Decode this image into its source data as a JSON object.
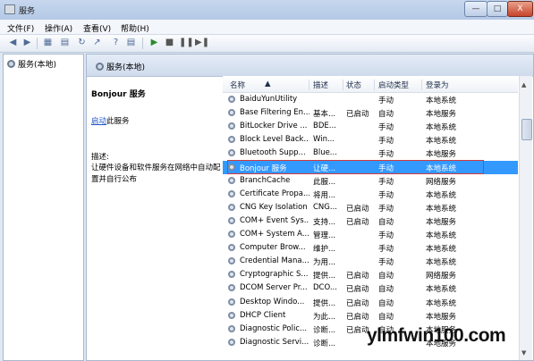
{
  "window": {
    "title": "服务",
    "controls": {
      "minimize": "—",
      "maximize": "□",
      "close": "X"
    }
  },
  "menu": [
    "文件(F)",
    "操作(A)",
    "查看(V)",
    "帮助(H)"
  ],
  "toolbar": {
    "buttons": [
      "back-icon",
      "forward-icon",
      "console-tree-icon",
      "properties-icon",
      "refresh-icon",
      "export-icon",
      "help-icon",
      "console-icon",
      "start-icon",
      "stop-icon",
      "pause-icon",
      "restart-icon"
    ]
  },
  "tree": {
    "root": "服务(本地)"
  },
  "right_header": "服务(本地)",
  "description": {
    "title": "Bonjour 服务",
    "start_link": "启动",
    "start_suffix": "此服务",
    "label": "描述:",
    "text": "让硬件设备和软件服务在网络中自动配置并自行公布"
  },
  "columns": [
    "名称",
    "描述",
    "状态",
    "启动类型",
    "登录为"
  ],
  "services": [
    {
      "name": "BaiduYunUtility",
      "desc": "",
      "status": "",
      "startup": "手动",
      "logon": "本地系统"
    },
    {
      "name": "Base Filtering En...",
      "desc": "基本...",
      "status": "已启动",
      "startup": "自动",
      "logon": "本地服务"
    },
    {
      "name": "BitLocker Drive ...",
      "desc": "BDE...",
      "status": "",
      "startup": "手动",
      "logon": "本地系统"
    },
    {
      "name": "Block Level Back...",
      "desc": "Win...",
      "status": "",
      "startup": "手动",
      "logon": "本地系统"
    },
    {
      "name": "Bluetooth Supp...",
      "desc": "Blue...",
      "status": "",
      "startup": "手动",
      "logon": "本地服务"
    },
    {
      "name": "Bonjour 服务",
      "desc": "让硬...",
      "status": "",
      "startup": "手动",
      "logon": "本地系统",
      "selected": true
    },
    {
      "name": "BranchCache",
      "desc": "此服...",
      "status": "",
      "startup": "手动",
      "logon": "网络服务"
    },
    {
      "name": "Certificate Propa...",
      "desc": "将用...",
      "status": "",
      "startup": "手动",
      "logon": "本地系统"
    },
    {
      "name": "CNG Key Isolation",
      "desc": "CNG...",
      "status": "已启动",
      "startup": "手动",
      "logon": "本地系统"
    },
    {
      "name": "COM+ Event Sys...",
      "desc": "支持...",
      "status": "已启动",
      "startup": "自动",
      "logon": "本地服务"
    },
    {
      "name": "COM+ System A...",
      "desc": "管理...",
      "status": "",
      "startup": "手动",
      "logon": "本地系统"
    },
    {
      "name": "Computer Brow...",
      "desc": "维护...",
      "status": "",
      "startup": "手动",
      "logon": "本地系统"
    },
    {
      "name": "Credential Mana...",
      "desc": "为用...",
      "status": "",
      "startup": "手动",
      "logon": "本地系统"
    },
    {
      "name": "Cryptographic S...",
      "desc": "提供...",
      "status": "已启动",
      "startup": "自动",
      "logon": "网络服务"
    },
    {
      "name": "DCOM Server Pr...",
      "desc": "DCO...",
      "status": "已启动",
      "startup": "自动",
      "logon": "本地系统"
    },
    {
      "name": "Desktop Windo...",
      "desc": "提供...",
      "status": "已启动",
      "startup": "自动",
      "logon": "本地系统"
    },
    {
      "name": "DHCP Client",
      "desc": "为此...",
      "status": "已启动",
      "startup": "自动",
      "logon": "本地服务"
    },
    {
      "name": "Diagnostic Polic...",
      "desc": "诊断...",
      "status": "已启动",
      "startup": "自动",
      "logon": "本地服务"
    },
    {
      "name": "Diagnostic Servi...",
      "desc": "诊断...",
      "status": "",
      "startup": "",
      "logon": "本地服务"
    }
  ],
  "watermark": "ylmfwin100.com"
}
